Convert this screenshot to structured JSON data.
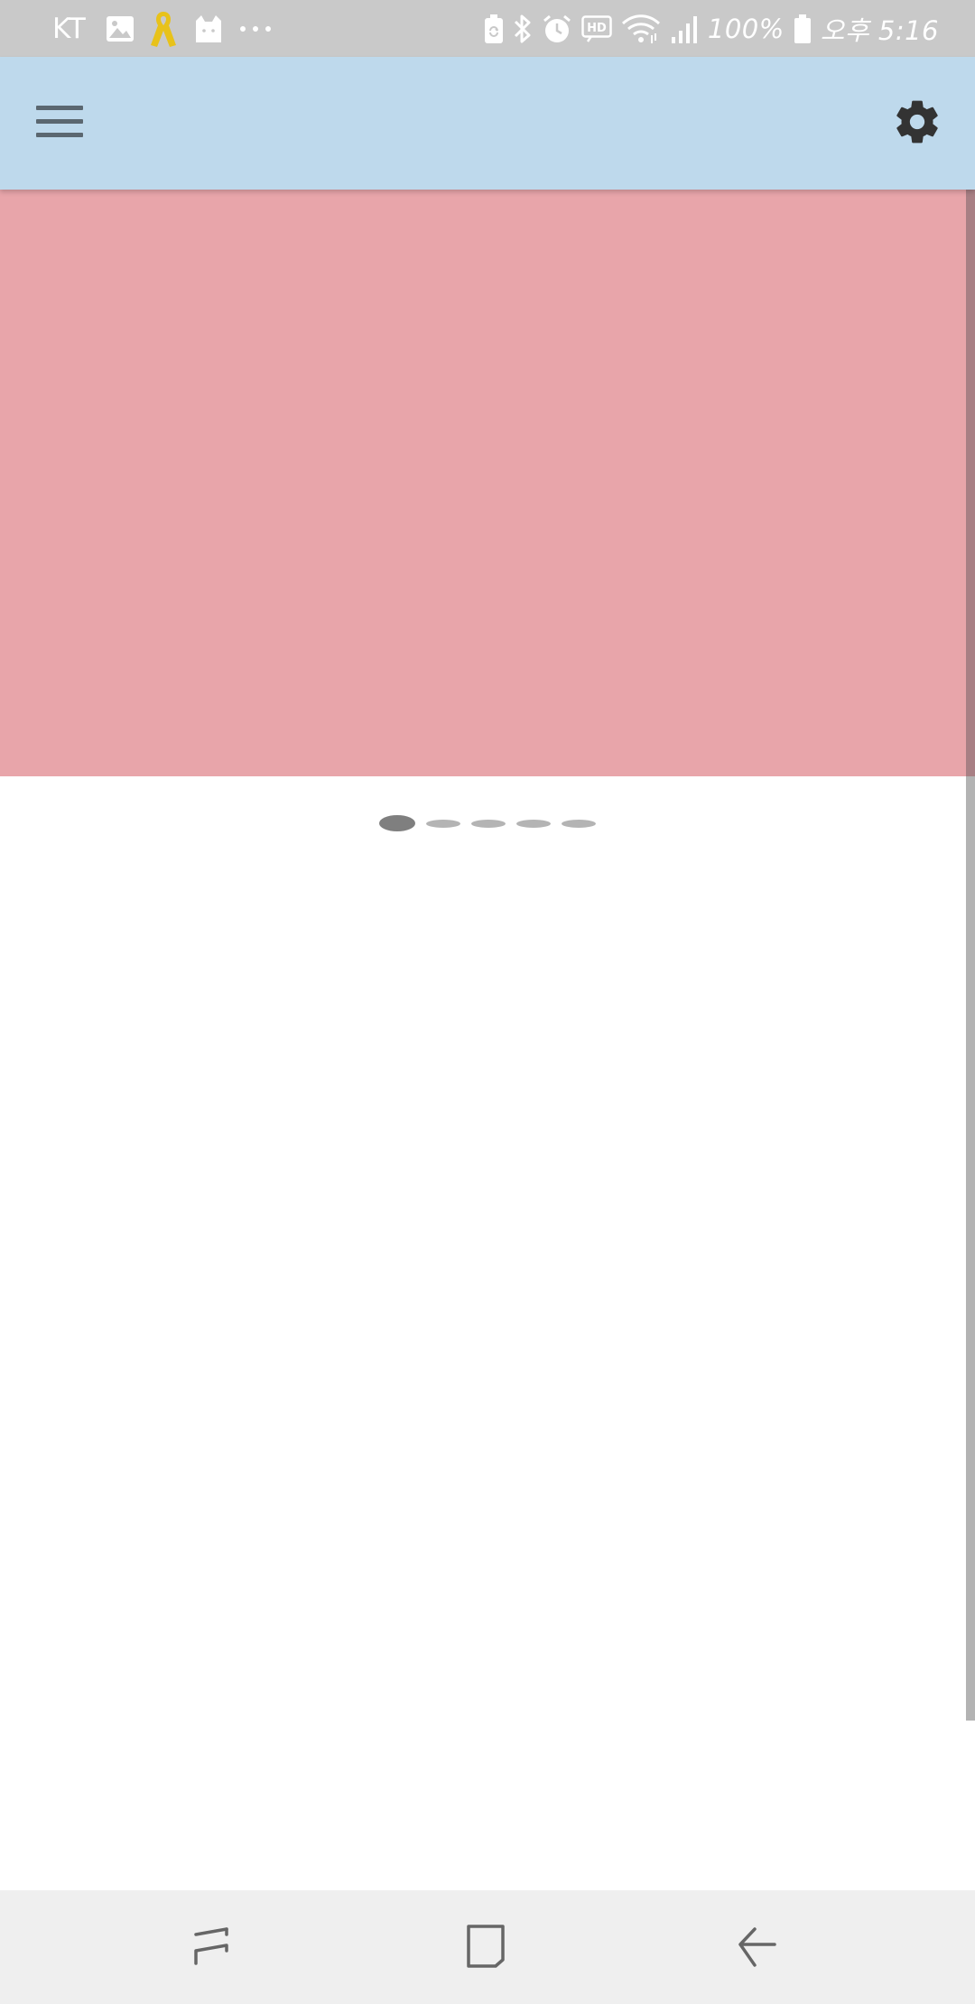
{
  "status_bar": {
    "carrier": "KT",
    "battery_percent": "100%",
    "time": "오후 5:16",
    "icons": [
      "gallery-icon",
      "yellow-ribbon-icon",
      "cat-icon",
      "more-dots-icon",
      "battery-saver-icon",
      "bluetooth-icon",
      "alarm-icon",
      "hd-icon",
      "wifi-icon",
      "signal-icon",
      "battery-icon"
    ]
  },
  "app_bar": {
    "icons": [
      "menu-icon",
      "settings-icon"
    ],
    "background_color": "#bed9ec"
  },
  "banner": {
    "background_color": "#e8a5aa"
  },
  "carousel": {
    "page_count": 5,
    "active_index": 0
  },
  "nav_bar": {
    "icons": [
      "recents-icon",
      "home-icon",
      "back-icon"
    ]
  }
}
